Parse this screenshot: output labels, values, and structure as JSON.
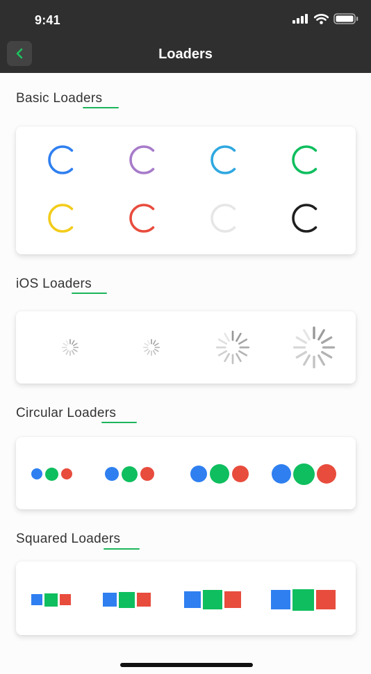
{
  "status_bar": {
    "time": "9:41",
    "icons": [
      "signal-icon",
      "wifi-icon",
      "battery-icon"
    ]
  },
  "nav": {
    "title": "Loaders",
    "back_icon": "chevron-left-icon"
  },
  "colors": {
    "accent": "#1cb45a",
    "blue": "#2f7ff0",
    "purple": "#a77bca",
    "cyan": "#2fa8e0",
    "green": "#0fbe5e",
    "yellow": "#f3cc1a",
    "red": "#e84c3d",
    "light": "#e6e6e6",
    "dark": "#1f1f1f"
  },
  "sections": {
    "basic": {
      "title": "Basic Loaders",
      "spinner_colors": [
        "blue",
        "purple",
        "cyan",
        "green",
        "yellow",
        "red",
        "light",
        "dark"
      ]
    },
    "ios": {
      "title": "iOS Loaders",
      "sizes": [
        "small",
        "small",
        "medium",
        "large"
      ]
    },
    "circular": {
      "title": "Circular Loaders",
      "colors": [
        "blue",
        "green",
        "red"
      ]
    },
    "squared": {
      "title": "Squared Loaders",
      "colors": [
        "blue",
        "green",
        "red"
      ]
    }
  }
}
